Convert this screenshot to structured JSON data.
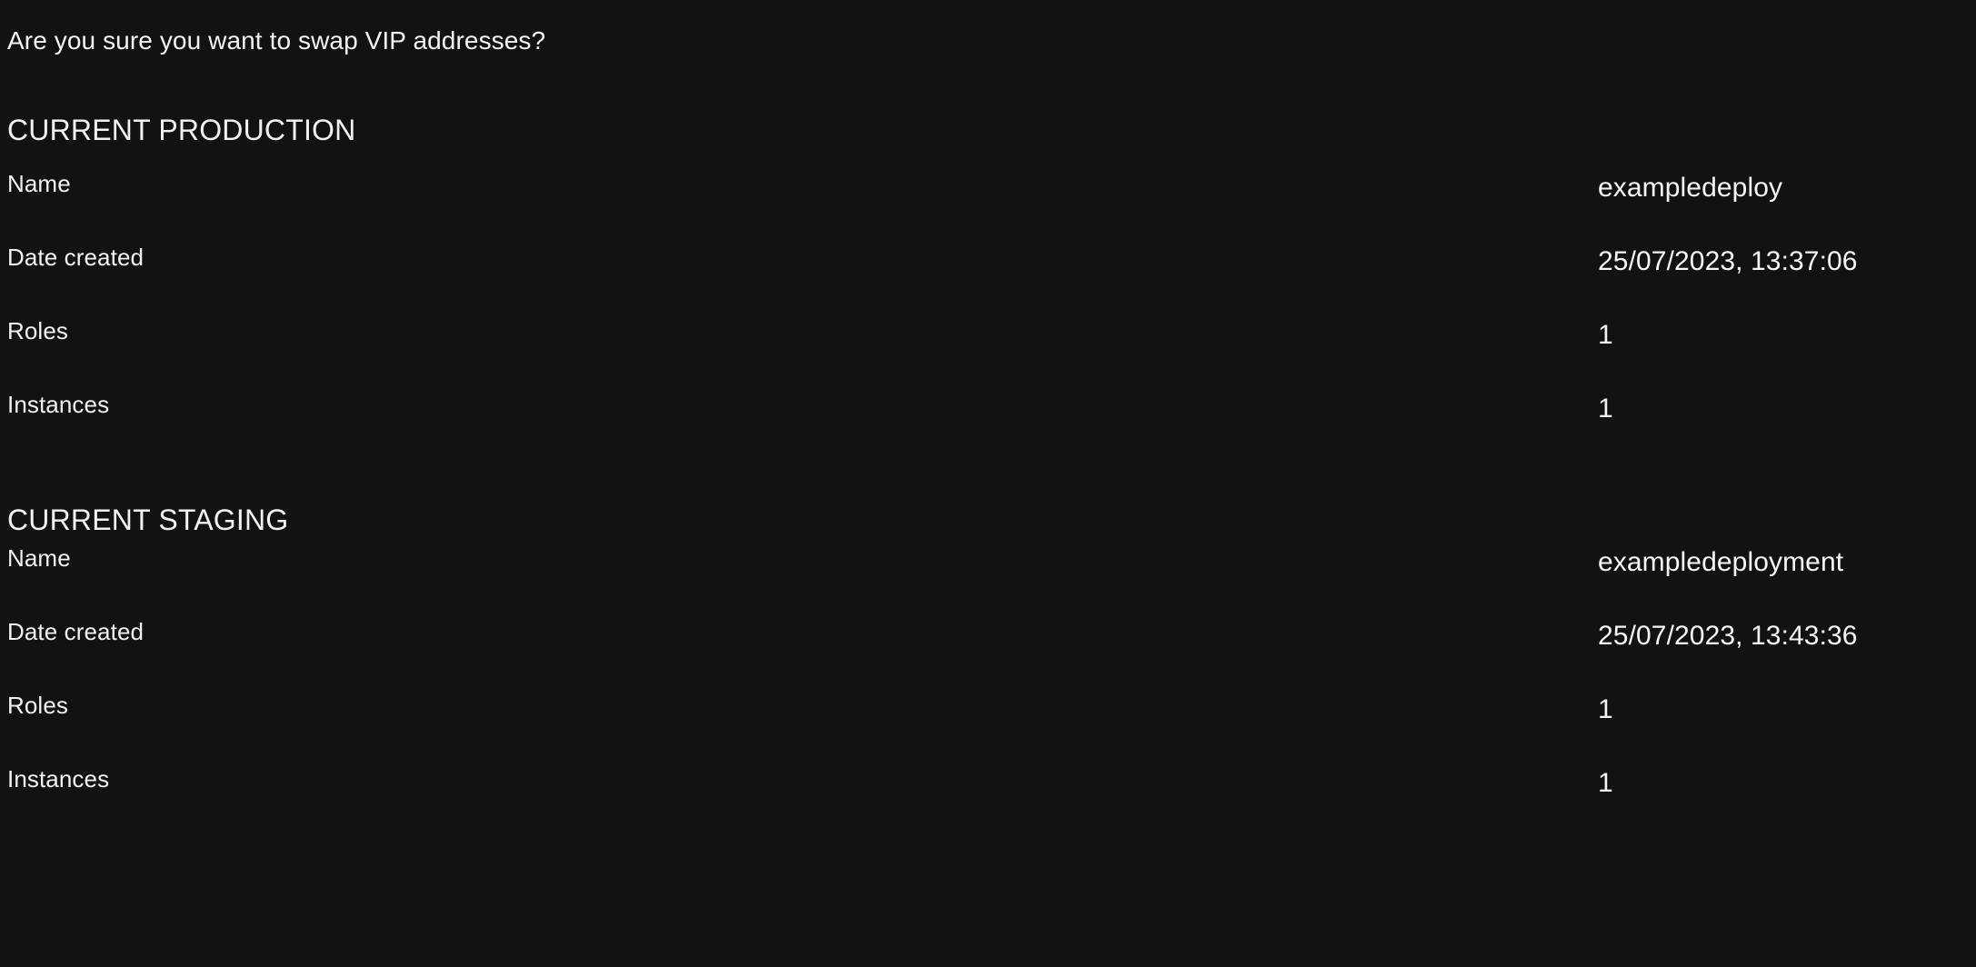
{
  "background_color": "#111214",
  "text_color": "#f2f2f2",
  "prompt": {
    "question": "Are you sure you want to swap VIP addresses?"
  },
  "sections": [
    {
      "heading": "CURRENT PRODUCTION",
      "rows": [
        {
          "label": "Name",
          "value": "exampledeploy"
        },
        {
          "label": "Date created",
          "value": "25/07/2023, 13:37:06"
        },
        {
          "label": "Roles",
          "value": "1"
        },
        {
          "label": "Instances",
          "value": "1"
        }
      ]
    },
    {
      "heading": "CURRENT STAGING",
      "rows": [
        {
          "label": "Name",
          "value": "exampledeployment"
        },
        {
          "label": "Date created",
          "value": "25/07/2023, 13:43:36"
        },
        {
          "label": "Roles",
          "value": "1"
        },
        {
          "label": "Instances",
          "value": "1"
        }
      ]
    }
  ]
}
